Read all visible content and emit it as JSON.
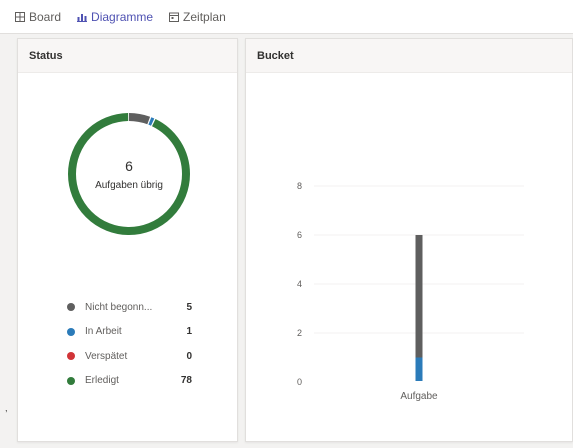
{
  "tabs": [
    {
      "label": "Board",
      "icon": "board-icon",
      "active": false
    },
    {
      "label": "Diagramme",
      "icon": "chart-icon",
      "active": true
    },
    {
      "label": "Zeitplan",
      "icon": "schedule-icon",
      "active": false
    }
  ],
  "status_card": {
    "title": "Status",
    "center_count": "6",
    "center_label": "Aufgaben übrig",
    "legend": [
      {
        "label": "Nicht begonn...",
        "value": "5",
        "color": "#5f5f5f"
      },
      {
        "label": "In Arbeit",
        "value": "1",
        "color": "#2b7bb9"
      },
      {
        "label": "Verspätet",
        "value": "0",
        "color": "#d13438"
      },
      {
        "label": "Erledigt",
        "value": "78",
        "color": "#327c3c"
      }
    ]
  },
  "bucket_card": {
    "title": "Bucket"
  },
  "chart_data": [
    {
      "type": "pie",
      "categories": [
        "Nicht begonn...",
        "In Arbeit",
        "Verspätet",
        "Erledigt"
      ],
      "values": [
        5,
        1,
        0,
        78
      ],
      "colors": [
        "#5f5f5f",
        "#2b7bb9",
        "#d13438",
        "#327c3c"
      ]
    },
    {
      "type": "bar",
      "stacked": true,
      "categories": [
        "Aufgabe"
      ],
      "series": [
        {
          "values": [
            1
          ],
          "color": "#2b7bb9"
        },
        {
          "values": [
            5
          ],
          "color": "#5f5f5f"
        }
      ],
      "yticks": [
        0,
        2,
        4,
        6,
        8
      ],
      "ylim": [
        0,
        8
      ],
      "grid": true
    }
  ]
}
